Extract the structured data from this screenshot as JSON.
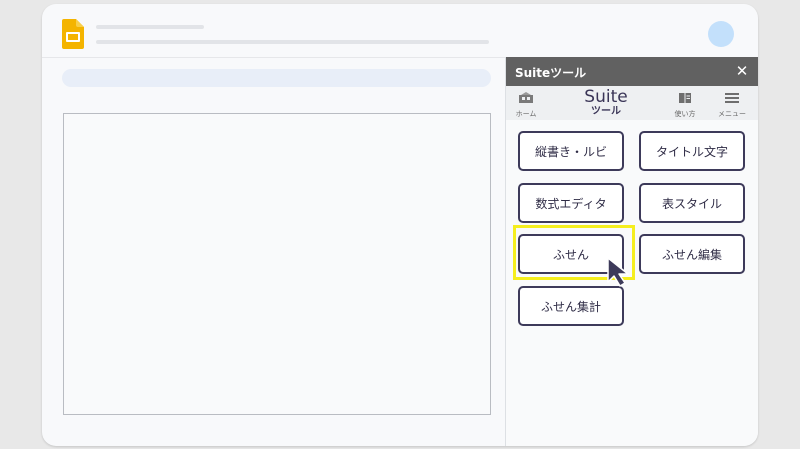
{
  "colors": {
    "panel_header": "#616161",
    "button_border": "#3d3a5a",
    "highlight": "#f5ee1e",
    "avatar": "#c3e0fb",
    "slides_logo": "#f4b400"
  },
  "icons": {
    "app_logo": "google-slides-icon",
    "close": "close-icon",
    "home": "home-icon",
    "usage": "book-icon",
    "menu": "hamburger-menu-icon",
    "pointer": "cursor-arrow-icon"
  },
  "panel": {
    "title": "Suiteツール",
    "close_glyph": "✕",
    "brand_main": "Suite",
    "brand_sub": "ツール",
    "nav": {
      "home_label": "ホーム",
      "usage_label": "使い方",
      "menu_label": "メニュー"
    },
    "buttons": [
      {
        "label": "縦書き・ルビ"
      },
      {
        "label": "タイトル文字"
      },
      {
        "label": "数式エディタ"
      },
      {
        "label": "表スタイル"
      },
      {
        "label": "ふせん"
      },
      {
        "label": "ふせん編集"
      },
      {
        "label": "ふせん集計"
      }
    ]
  }
}
